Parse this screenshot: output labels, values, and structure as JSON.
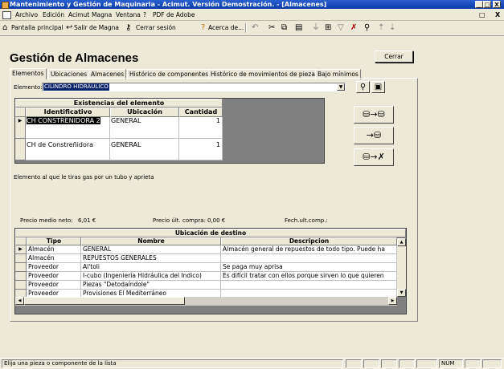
{
  "window": {
    "title": "Mantenimiento y Gestión de Maquinaria - Acimut. Versión Demostración. - [Almacenes]",
    "controls": [
      "_",
      "□",
      "X"
    ],
    "mdi_controls": [
      "_",
      "□",
      "X"
    ]
  },
  "menu": [
    "Archivo",
    "Edición",
    "Acimut",
    "Magna",
    "Ventana",
    "?",
    "PDF de Adobe"
  ],
  "toolbar": {
    "main_label": "Pantalla principal",
    "exit_label": "Salir de Magna",
    "logout_label": "Cerrar sesión",
    "about_label": "Acerca de..."
  },
  "page": {
    "title": "Gestión de Almacenes",
    "close_label": "Cerrar"
  },
  "tabs": [
    "Elementos",
    "Ubicaciones",
    "Almacenes",
    "Histórico de componentes",
    "Histórico de movimientos de piezas",
    "Bajo mínimos"
  ],
  "element": {
    "label": "Elemento:",
    "value": "CILINDRO HIDRÁULICO"
  },
  "stock_grid": {
    "caption": "Existencias del elemento",
    "columns": [
      "Identificativo",
      "Ubicación",
      "Cantidad"
    ],
    "rows": [
      {
        "id": "CH CONSTRENIDORA 2",
        "location": "GENERAL",
        "qty": "1"
      },
      {
        "id": "CH de Constreñidora",
        "location": "GENERAL",
        "qty": "1"
      }
    ]
  },
  "description": "Elemento al que le tiras gas por un tubo y aprieta",
  "prices": {
    "avg_label": "Precio medio neto:",
    "avg_value": "6,01 €",
    "last_label": "Precio últ. compra:",
    "last_value": "0,00 €",
    "date_label": "Fech.ult.comp.:"
  },
  "dest_grid": {
    "caption": "Ubicación de destino",
    "columns": [
      "Tipo",
      "Nombre",
      "Descripcion"
    ],
    "rows": [
      {
        "tipo": "Almacén",
        "nombre": "GENERAL",
        "desc": "Almacén general de repuestos de todo tipo. Puede ha"
      },
      {
        "tipo": "Almacén",
        "nombre": "REPUESTOS GENERALES",
        "desc": ""
      },
      {
        "tipo": "Proveedor",
        "nombre": "Al'toli",
        "desc": "Se paga muy aprisa"
      },
      {
        "tipo": "Proveedor",
        "nombre": "I-cubo (Ingeniería Hidráulica del Indico)",
        "desc": "Es difícil tratar con ellos porque sirven lo que quieren"
      },
      {
        "tipo": "Proveedor",
        "nombre": "Piezas \"Detodaíndole\"",
        "desc": ""
      },
      {
        "tipo": "Proveedor",
        "nombre": "Provisiones El Mediterráneo",
        "desc": ""
      }
    ]
  },
  "status": {
    "message": "Elija una pieza o componente de la lista",
    "num": "NUM"
  }
}
